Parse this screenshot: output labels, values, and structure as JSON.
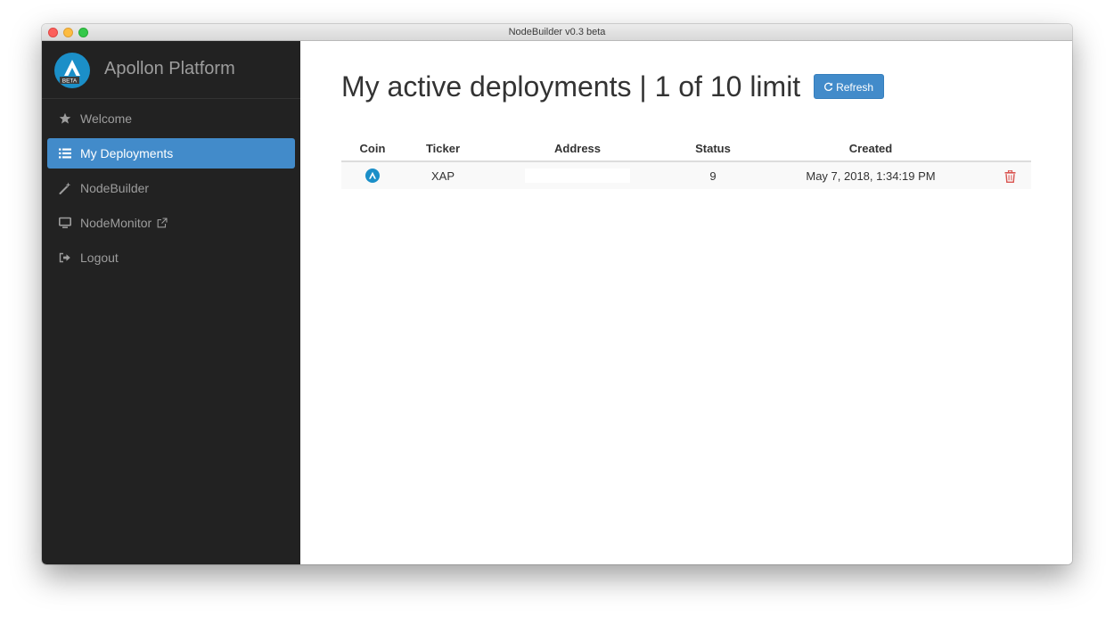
{
  "window": {
    "title": "NodeBuilder v0.3 beta"
  },
  "brand": {
    "name": "Apollon Platform",
    "badge": "BETA"
  },
  "sidebar": {
    "items": [
      {
        "label": "Welcome",
        "icon": "star-icon",
        "active": false
      },
      {
        "label": "My Deployments",
        "icon": "list-icon",
        "active": true
      },
      {
        "label": "NodeBuilder",
        "icon": "magic-wand-icon",
        "active": false
      },
      {
        "label": "NodeMonitor",
        "icon": "monitor-icon",
        "active": false,
        "external": true
      },
      {
        "label": "Logout",
        "icon": "logout-icon",
        "active": false
      }
    ]
  },
  "main": {
    "heading": "My active deployments | 1 of 10 limit",
    "refresh_label": "Refresh"
  },
  "table": {
    "columns": [
      "Coin",
      "Ticker",
      "Address",
      "Status",
      "Created",
      ""
    ],
    "rows": [
      {
        "coin_icon": "apollon-coin-icon",
        "ticker": "XAP",
        "address": "",
        "status": "9",
        "created": "May 7, 2018, 1:34:19 PM"
      }
    ]
  },
  "colors": {
    "sidebar_bg": "#222222",
    "accent": "#428bca",
    "danger": "#d9534f",
    "coin": "#1b8fc8"
  }
}
